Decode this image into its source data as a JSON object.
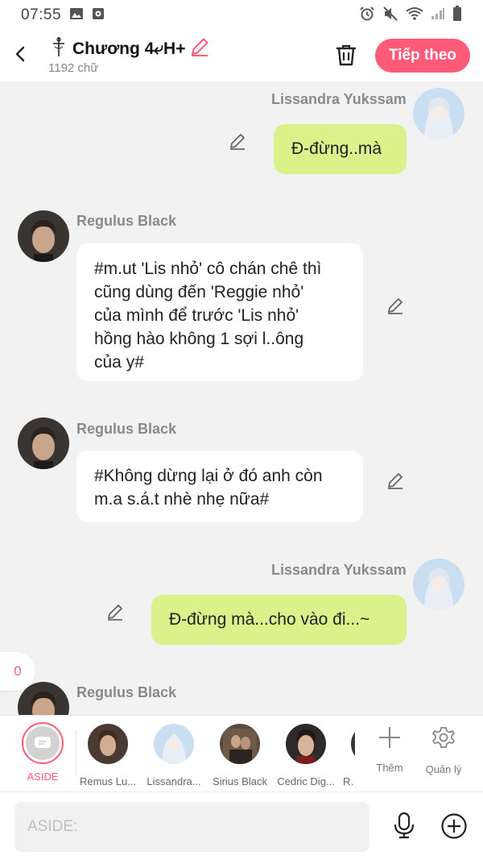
{
  "status_bar": {
    "time": "07:55"
  },
  "header": {
    "title": "Chương 4⤶H+",
    "subtitle": "1192 chữ",
    "next_label": "Tiếp theo"
  },
  "messages": [
    {
      "side": "right",
      "sender": "Lissandra Yukssam",
      "text": "Đ-đừng..mà"
    },
    {
      "side": "left",
      "sender": "Regulus Black",
      "lines": [
        "#m.ut 'Lis nhỏ' cô chán chê thì",
        "cũng dùng đến 'Reggie nhỏ'",
        "của mình để trước 'Lis nhỏ'",
        "hồng hào không 1 sợi l..ông",
        "của y#"
      ]
    },
    {
      "side": "left",
      "sender": "Regulus Black",
      "lines": [
        "#Không dừng lại ở đó anh còn",
        "m.a s.á.t nhè nhẹ nữa#"
      ]
    },
    {
      "side": "right",
      "sender": "Lissandra Yukssam",
      "text": "Đ-đừng mà...cho vào đi...~"
    },
    {
      "side": "left",
      "sender": "Regulus Black"
    }
  ],
  "counter": "0",
  "character_bar": {
    "aside_label": "ASIDE",
    "characters": [
      "Remus Lu...",
      "Lissandra...",
      "Sirius Black",
      "Cedric Dig...",
      "Re"
    ],
    "add_label": "Thêm",
    "manage_label": "Quản lý"
  },
  "input": {
    "placeholder": "ASIDE:"
  },
  "colors": {
    "accent": "#ff5b78",
    "my_bubble": "#d9f28a",
    "their_bubble": "#ffffff",
    "background": "#f2f2f2"
  }
}
